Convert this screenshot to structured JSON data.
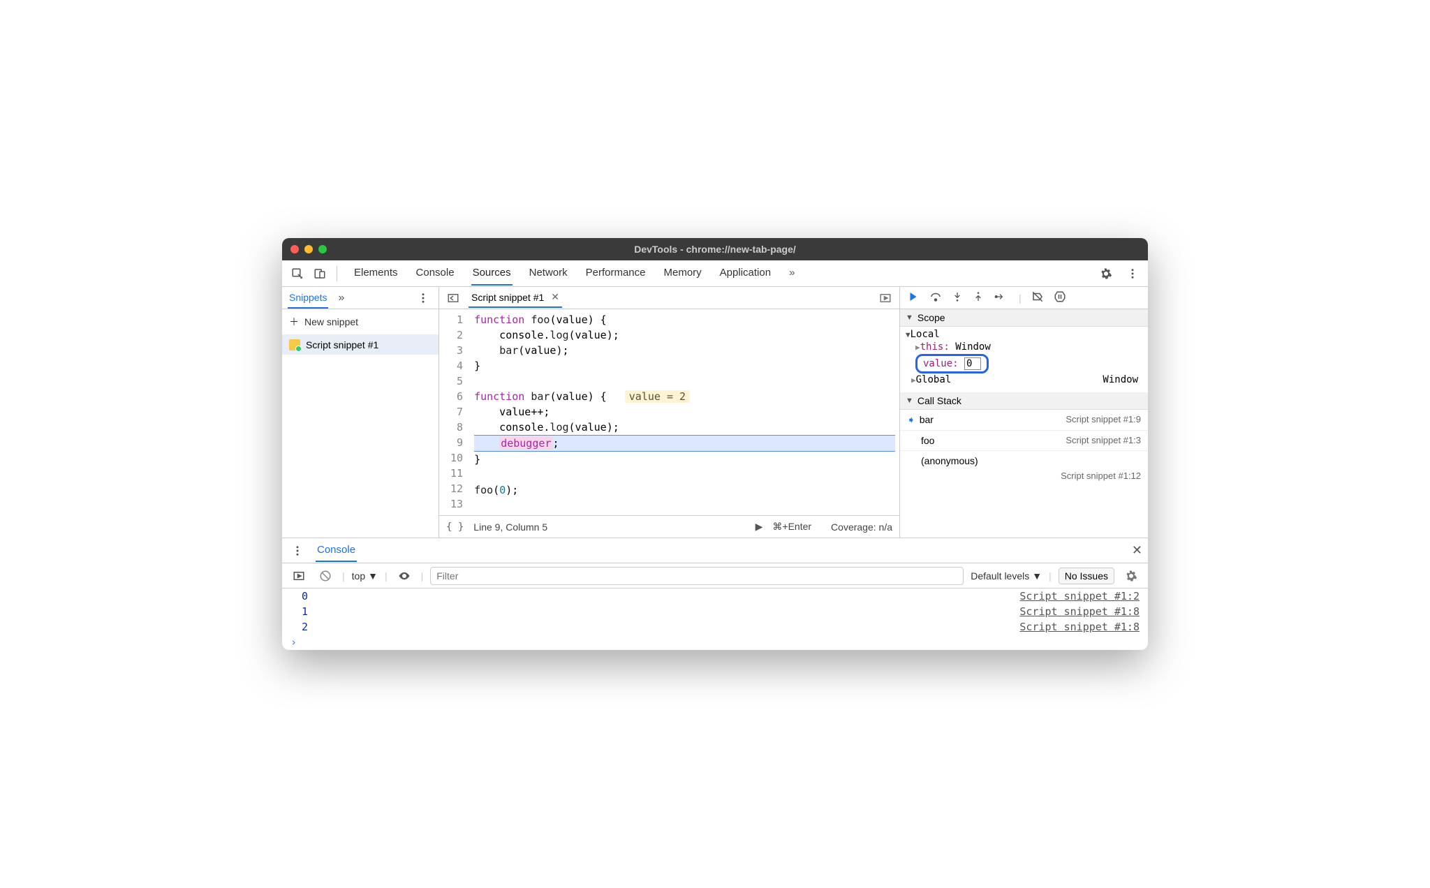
{
  "titlebar": {
    "title": "DevTools - chrome://new-tab-page/"
  },
  "tabs": {
    "items": [
      "Elements",
      "Console",
      "Sources",
      "Network",
      "Performance",
      "Memory",
      "Application"
    ],
    "active": "Sources"
  },
  "sidebar": {
    "tab": "Snippets",
    "new_label": "New snippet",
    "items": [
      "Script snippet #1"
    ]
  },
  "editor": {
    "tab_label": "Script snippet #1",
    "lines": [
      "function foo(value) {",
      "    console.log(value);",
      "    bar(value);",
      "}",
      "",
      "function bar(value) {",
      "    value++;",
      "    console.log(value);",
      "    debugger;",
      "}",
      "",
      "foo(0);",
      ""
    ],
    "inline_hint": "value = 2",
    "footer": {
      "position": "Line 9, Column 5",
      "shortcut": "⌘+Enter",
      "coverage": "Coverage: n/a"
    }
  },
  "scope": {
    "header": "Scope",
    "local": {
      "label": "Local",
      "this_label": "this:",
      "this_value": "Window",
      "value_label": "value:",
      "value_value": "0"
    },
    "global": {
      "label": "Global",
      "value": "Window"
    }
  },
  "callstack": {
    "header": "Call Stack",
    "frames": [
      {
        "name": "bar",
        "loc": "Script snippet #1:9"
      },
      {
        "name": "foo",
        "loc": "Script snippet #1:3"
      }
    ],
    "anon": "(anonymous)",
    "anon_loc": "Script snippet #1:12"
  },
  "console": {
    "tab": "Console",
    "context": "top",
    "filter_placeholder": "Filter",
    "levels": "Default levels",
    "issues": "No Issues",
    "logs": [
      {
        "value": "0",
        "src": "Script snippet #1:2"
      },
      {
        "value": "1",
        "src": "Script snippet #1:8"
      },
      {
        "value": "2",
        "src": "Script snippet #1:8"
      }
    ]
  }
}
